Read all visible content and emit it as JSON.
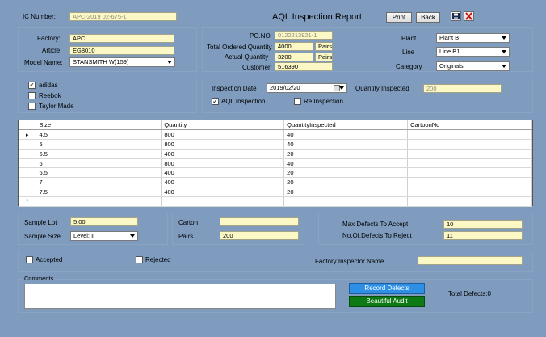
{
  "header": {
    "ic_number_label": "IC Number:",
    "ic_number_value": "APC-2019 02-675-1",
    "title": "AQL Inspection Report",
    "print_label": "Print",
    "back_label": "Back",
    "save_icon": "save-icon",
    "close_icon": "close-icon"
  },
  "product": {
    "factory_label": "Factory:",
    "factory_value": "APC",
    "article_label": "Article:",
    "article_value": "EG8010",
    "model_label": "Model Name:",
    "model_value": "STANSMITH W(159)"
  },
  "order": {
    "po_label": "PO.NO",
    "po_value": "0122213921-1",
    "total_qty_label": "Total Ordered Quantity",
    "total_qty_value": "4000",
    "total_qty_unit": "Pairs",
    "actual_qty_label": "Actual Quantity",
    "actual_qty_value": "3200",
    "actual_qty_unit": "Pairs",
    "customer_label": "Customer",
    "customer_value": "516390",
    "plant_label": "Plant",
    "plant_value": "Plant B",
    "line_label": "Line",
    "line_value": "Line B1",
    "category_label": "Category",
    "category_value": "Originals"
  },
  "brands": [
    {
      "label": "adidas",
      "checked": true
    },
    {
      "label": "Reebok",
      "checked": false
    },
    {
      "label": "Taylor Made",
      "checked": false
    }
  ],
  "inspection": {
    "date_label": "Inspection Date",
    "date_value": "2019/02/20",
    "qty_inspected_label": "Quantity Inspected",
    "qty_inspected_value": "200",
    "aql_label": "AQL Inspection",
    "aql_checked": true,
    "re_label": "Re Inspection",
    "re_checked": false
  },
  "grid": {
    "columns": [
      "Size",
      "Quantity",
      "QuantityInspected",
      "CartoonNo"
    ],
    "rows": [
      [
        "4.5",
        "800",
        "40",
        ""
      ],
      [
        "5",
        "800",
        "40",
        ""
      ],
      [
        "5.5",
        "400",
        "20",
        ""
      ],
      [
        "6",
        "800",
        "40",
        ""
      ],
      [
        "6.5",
        "400",
        "20",
        ""
      ],
      [
        "7",
        "400",
        "20",
        ""
      ],
      [
        "7.5",
        "400",
        "20",
        ""
      ]
    ],
    "current_marker": "▸",
    "new_marker": "*"
  },
  "sampling": {
    "lot_label": "Sample Lot",
    "lot_value": "5.00",
    "size_label": "Sample Size",
    "size_value": "Level: II",
    "carton_label": "Carton",
    "carton_value": "",
    "pairs_label": "Pairs",
    "pairs_value": "200",
    "max_defects_label": "Max Defects To Accept",
    "max_defects_value": "10",
    "reject_label": "No.Of.Defects To Reject",
    "reject_value": "11"
  },
  "result": {
    "accepted_label": "Accepted",
    "rejected_label": "Rejected",
    "inspector_label": "Factory Inspector Name",
    "inspector_value": ""
  },
  "comments": {
    "label": "Comments",
    "value": "",
    "record_defects_label": "Record Defects",
    "beautiful_audit_label": "Beautiful Audit",
    "total_defects_label": "Total Defects:0"
  },
  "colors": {
    "background": "#7f9cbf",
    "field_bg": "#fbf8c5",
    "record_button": "#2e8fe6",
    "audit_button": "#0e7a16"
  }
}
